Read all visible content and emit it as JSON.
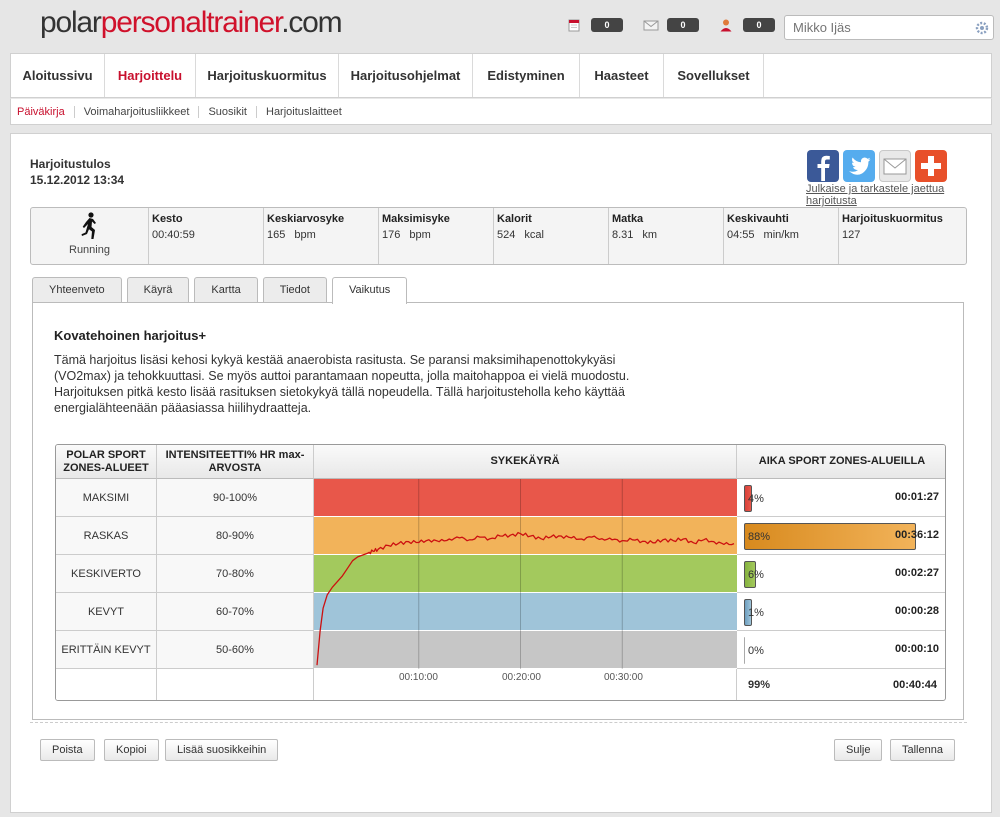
{
  "header": {
    "logo": {
      "part1": "polar",
      "part2": "personaltrainer",
      "part3": ".com"
    },
    "counters": [
      {
        "icon": "calendar-icon",
        "value": "0"
      },
      {
        "icon": "mail-icon",
        "value": "0"
      },
      {
        "icon": "user-icon",
        "value": "0"
      }
    ],
    "search": {
      "placeholder": "Mikko Ijäs"
    }
  },
  "nav": {
    "items": [
      {
        "label": "Aloitussivu",
        "active": false
      },
      {
        "label": "Harjoittelu",
        "active": true
      },
      {
        "label": "Harjoituskuormitus",
        "active": false
      },
      {
        "label": "Harjoitusohjelmat",
        "active": false
      },
      {
        "label": "Edistyminen",
        "active": false
      },
      {
        "label": "Haasteet",
        "active": false
      },
      {
        "label": "Sovellukset",
        "active": false
      }
    ]
  },
  "subnav": {
    "items": [
      {
        "label": "Päiväkirja",
        "active": true
      },
      {
        "label": "Voimaharjoitusliikkeet",
        "active": false
      },
      {
        "label": "Suosikit",
        "active": false
      },
      {
        "label": "Harjoituslaitteet",
        "active": false
      }
    ]
  },
  "exercise": {
    "title": "Harjoitustulos",
    "datetime": "15.12.2012 13:34"
  },
  "social": {
    "link_text": "Julkaise ja tarkastele jaettua harjoitusta",
    "colors": {
      "facebook": "#3b5998",
      "twitter": "#55acee",
      "email": "#e8e8e8",
      "plus": "#e8502a"
    }
  },
  "summary": {
    "sport": "Running",
    "metrics": [
      {
        "label": "Kesto",
        "value": "00:40:59",
        "unit": ""
      },
      {
        "label": "Keskiarvosyke",
        "value": "165",
        "unit": "bpm"
      },
      {
        "label": "Maksimisyke",
        "value": "176",
        "unit": "bpm"
      },
      {
        "label": "Kalorit",
        "value": "524",
        "unit": "kcal"
      },
      {
        "label": "Matka",
        "value": "8.31",
        "unit": "km"
      },
      {
        "label": "Keskivauhti",
        "value": "04:55",
        "unit": "min/km"
      },
      {
        "label": "Harjoituskuormitus",
        "value": "127",
        "unit": ""
      }
    ]
  },
  "tabs": [
    {
      "label": "Yhteenveto",
      "active": false
    },
    {
      "label": "Käyrä",
      "active": false
    },
    {
      "label": "Kartta",
      "active": false
    },
    {
      "label": "Tiedot",
      "active": false
    },
    {
      "label": "Vaikutus",
      "active": true
    }
  ],
  "effect": {
    "title": "Kovatehoinen harjoitus+",
    "text": "Tämä harjoitus lisäsi kehosi kykyä kestää anaerobista rasitusta. Se paransi maksimihapenottokykyäsi (VO2max) ja tehokkuuttasi. Se myös auttoi parantamaan nopeutta, jolla maitohappoa ei vielä muodostu. Harjoituksen pitkä kesto lisää rasituksen sietokykyä tällä nopeudella. Tällä harjoitusteholla keho käyttää energialähteenään pääasiassa hiilihydraatteja."
  },
  "zones_table": {
    "headers": {
      "zone": "POLAR SPORT ZONES-ALUEET",
      "intensity": "INTENSITEETTI% HR max-ARVOSTA",
      "curve": "SYKEKÄYRÄ",
      "time": "AIKA SPORT ZONES-ALUEILLA"
    },
    "rows": [
      {
        "name": "MAKSIMI",
        "range": "90-100%",
        "percent": "4%",
        "fraction": 0.04,
        "time": "00:01:27",
        "color": "#e8574a",
        "bar_color": "#d9423a"
      },
      {
        "name": "RASKAS",
        "range": "80-90%",
        "percent": "88%",
        "fraction": 0.88,
        "time": "00:36:12",
        "color": "#f2b35a",
        "bar_color": "#d88a1e"
      },
      {
        "name": "KESKIVERTO",
        "range": "70-80%",
        "percent": "6%",
        "fraction": 0.06,
        "time": "00:02:27",
        "color": "#a3c95d",
        "bar_color": "#86b33f"
      },
      {
        "name": "KEVYT",
        "range": "60-70%",
        "percent": "1%",
        "fraction": 0.01,
        "time": "00:00:28",
        "color": "#9fc4d9",
        "bar_color": "#6d9fc0"
      },
      {
        "name": "ERITTÄIN KEVYT",
        "range": "50-60%",
        "percent": "0%",
        "fraction": 0.0,
        "time": "00:00:10",
        "color": "#c6c6c6",
        "bar_color": "#aaaaaa"
      }
    ],
    "total": {
      "percent": "99%",
      "time": "00:40:44"
    },
    "axis_labels": [
      "00:10:00",
      "00:20:00",
      "00:30:00"
    ]
  },
  "chart_data": {
    "type": "line",
    "title": "SYKEKÄYRÄ",
    "xlabel": "",
    "ylabel": "",
    "x_unit": "minutes",
    "xlim": [
      0,
      40.98
    ],
    "ylim": [
      50,
      100
    ],
    "x_ticks": [
      "00:10:00",
      "00:20:00",
      "00:30:00"
    ],
    "bands": [
      {
        "label": "MAKSIMI",
        "from": 90,
        "to": 100
      },
      {
        "label": "RASKAS",
        "from": 80,
        "to": 90
      },
      {
        "label": "KESKIVERTO",
        "from": 70,
        "to": 80
      },
      {
        "label": "KEVYT",
        "from": 60,
        "to": 70
      },
      {
        "label": "ERITTÄIN KEVYT",
        "from": 50,
        "to": 60
      }
    ],
    "series": [
      {
        "color": "#cc1010",
        "x": [
          0,
          0.3,
          0.6,
          1.0,
          1.5,
          2.0,
          2.5,
          3.0,
          3.5,
          4.0,
          4.5,
          5.0,
          5.5,
          6.0,
          7.0,
          8.0,
          9.0,
          10.0,
          11.0,
          12.0,
          13.0,
          14.0,
          15.0,
          16.0,
          17.0,
          18.0,
          19.0,
          20.0,
          21.0,
          22.0,
          23.0,
          24.0,
          25.0,
          26.0,
          27.0,
          28.0,
          29.0,
          30.0,
          31.0,
          32.0,
          33.0,
          34.0,
          35.0,
          36.0,
          37.0,
          38.0,
          39.0,
          40.0,
          40.98
        ],
        "y": [
          51,
          60,
          66,
          69.5,
          71.5,
          73,
          74.5,
          76.5,
          78.5,
          79.5,
          80,
          80.5,
          81,
          81.5,
          82.5,
          83,
          83.5,
          83.3,
          84,
          83.5,
          84.2,
          84.5,
          84,
          84.7,
          84.3,
          85,
          85.2,
          85.6,
          85,
          84.3,
          84.8,
          85,
          84.5,
          84.2,
          84.7,
          84.3,
          84,
          83.8,
          84,
          83.6,
          83.2,
          84,
          83.8,
          84.2,
          83.2,
          84,
          83.5,
          82.8,
          83
        ]
      }
    ]
  },
  "buttons": {
    "left": [
      "Poista",
      "Kopioi",
      "Lisää suosikkeihin"
    ],
    "right": [
      "Sulje",
      "Tallenna"
    ]
  }
}
